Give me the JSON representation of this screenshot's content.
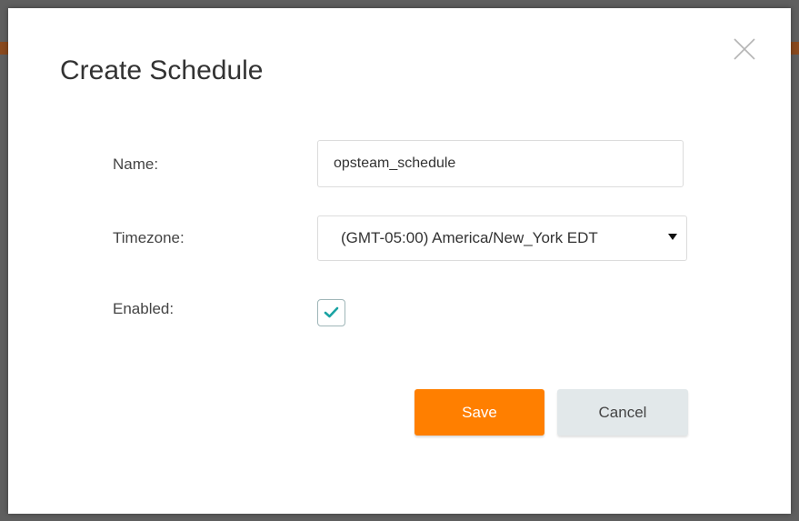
{
  "dialog": {
    "title": "Create Schedule",
    "close_label": "X"
  },
  "form": {
    "name": {
      "label": "Name:",
      "value": "opsteam_schedule"
    },
    "timezone": {
      "label": "Timezone:",
      "selected": "(GMT-05:00) America/New_York EDT"
    },
    "enabled": {
      "label": "Enabled:",
      "checked": true
    }
  },
  "buttons": {
    "save_label": "Save",
    "cancel_label": "Cancel"
  },
  "colors": {
    "accent": "#ff7f00",
    "checkmark": "#1aa3a3",
    "cancel_bg": "#e2e8ea"
  },
  "icons": {
    "close": "close-icon",
    "dropdown": "caret-down-icon",
    "check": "checkmark-icon"
  }
}
